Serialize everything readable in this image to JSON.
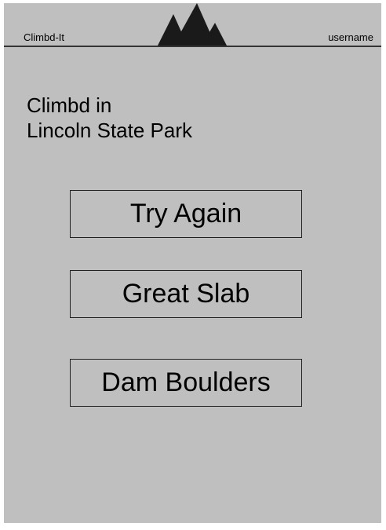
{
  "header": {
    "app_name": "Climbd-It",
    "username": "username",
    "logo_icon": "mountain-icon"
  },
  "main": {
    "title_line1": "Climbd in",
    "title_line2": "Lincoln State Park",
    "routes": [
      {
        "label": "Try Again"
      },
      {
        "label": "Great Slab"
      },
      {
        "label": "Dam Boulders"
      }
    ]
  },
  "colors": {
    "background": "#bfbfbf",
    "border": "#222222",
    "logo": "#1a1a1a"
  }
}
